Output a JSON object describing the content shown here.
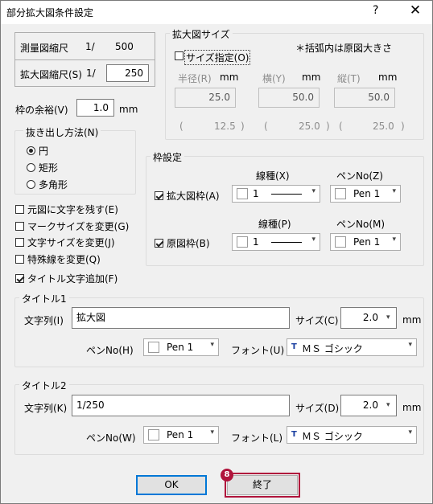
{
  "window": {
    "title": "部分拡大図条件設定",
    "help": "?",
    "close": "✕"
  },
  "scale": {
    "survey_label": "測量図縮尺",
    "survey_prefix": "1/",
    "survey_value": "500",
    "enlarge_label": "拡大図縮尺(S)",
    "enlarge_prefix": "1/",
    "enlarge_value": "250"
  },
  "margin": {
    "label": "枠の余裕(V)",
    "value": "1.0",
    "unit": "mm"
  },
  "extraction": {
    "legend": "抜き出し方法(N)",
    "options": [
      "円",
      "矩形",
      "多角形"
    ],
    "selected": 0
  },
  "options": [
    {
      "label": "元図に文字を残す(E)",
      "checked": false
    },
    {
      "label": "マークサイズを変更(G)",
      "checked": false
    },
    {
      "label": "文字サイズを変更(J)",
      "checked": false
    },
    {
      "label": "特殊線を変更(Q)",
      "checked": false
    },
    {
      "label": "タイトル文字追加(F)",
      "checked": true
    }
  ],
  "size_group": {
    "legend": "拡大図サイズ",
    "specify_label": "サイズ指定(O)",
    "note": "＊括弧内は原図大きさ",
    "radius_label": "半径(R)",
    "radius_unit": "mm",
    "radius_value": "25.0",
    "width_label": "横(Y)",
    "width_unit": "mm",
    "width_value": "50.0",
    "height_label": "縦(T)",
    "height_unit": "mm",
    "height_value": "50.0",
    "orig_radius": "12.5",
    "orig_width": "25.0",
    "orig_height": "25.0",
    "paren_open": "(",
    "paren_close": ")"
  },
  "frame": {
    "legend": "枠設定",
    "linetype_label": "線種(X)",
    "pen_label": "ペンNo(Z)",
    "enlarge_frame_label": "拡大図枠(A)",
    "enlarge_frame_checked": true,
    "enlarge_linetype": "1",
    "enlarge_pen": "Pen 1",
    "linetype2_label": "線種(P)",
    "pen2_label": "ペンNo(M)",
    "orig_frame_label": "原図枠(B)",
    "orig_frame_checked": true,
    "orig_linetype": "1",
    "orig_pen": "Pen 1"
  },
  "title1": {
    "legend": "タイトル1",
    "text_label": "文字列(I)",
    "text_value": "拡大図",
    "size_label": "サイズ(C)",
    "size_value": "2.0",
    "size_unit": "mm",
    "pen_label": "ペンNo(H)",
    "pen_value": "Pen 1",
    "font_label": "フォント(U)",
    "font_value": "ＭＳ ゴシック"
  },
  "title2": {
    "legend": "タイトル2",
    "text_label": "文字列(K)",
    "text_value": "1/250",
    "size_label": "サイズ(D)",
    "size_value": "2.0",
    "size_unit": "mm",
    "pen_label": "ペンNo(W)",
    "pen_value": "Pen 1",
    "font_label": "フォント(L)",
    "font_value": "ＭＳ ゴシック"
  },
  "buttons": {
    "ok": "OK",
    "finish": "終了",
    "step_badge": "8"
  },
  "colors": {
    "highlight": "#b0143c"
  },
  "icons": {
    "font_icon": "TrueType",
    "font_icon_glyph": "T"
  }
}
